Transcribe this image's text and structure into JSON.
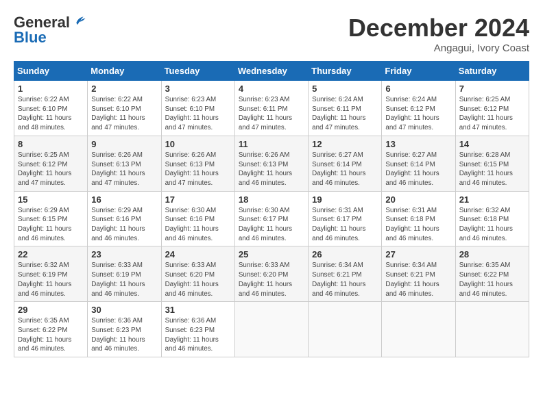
{
  "header": {
    "logo_line1": "General",
    "logo_line2": "Blue",
    "month": "December 2024",
    "location": "Angagui, Ivory Coast"
  },
  "weekdays": [
    "Sunday",
    "Monday",
    "Tuesday",
    "Wednesday",
    "Thursday",
    "Friday",
    "Saturday"
  ],
  "weeks": [
    [
      {
        "day": 1,
        "sunrise": "6:22 AM",
        "sunset": "6:10 PM",
        "daylight": "11 hours and 48 minutes."
      },
      {
        "day": 2,
        "sunrise": "6:22 AM",
        "sunset": "6:10 PM",
        "daylight": "11 hours and 47 minutes."
      },
      {
        "day": 3,
        "sunrise": "6:23 AM",
        "sunset": "6:10 PM",
        "daylight": "11 hours and 47 minutes."
      },
      {
        "day": 4,
        "sunrise": "6:23 AM",
        "sunset": "6:11 PM",
        "daylight": "11 hours and 47 minutes."
      },
      {
        "day": 5,
        "sunrise": "6:24 AM",
        "sunset": "6:11 PM",
        "daylight": "11 hours and 47 minutes."
      },
      {
        "day": 6,
        "sunrise": "6:24 AM",
        "sunset": "6:12 PM",
        "daylight": "11 hours and 47 minutes."
      },
      {
        "day": 7,
        "sunrise": "6:25 AM",
        "sunset": "6:12 PM",
        "daylight": "11 hours and 47 minutes."
      }
    ],
    [
      {
        "day": 8,
        "sunrise": "6:25 AM",
        "sunset": "6:12 PM",
        "daylight": "11 hours and 47 minutes."
      },
      {
        "day": 9,
        "sunrise": "6:26 AM",
        "sunset": "6:13 PM",
        "daylight": "11 hours and 47 minutes."
      },
      {
        "day": 10,
        "sunrise": "6:26 AM",
        "sunset": "6:13 PM",
        "daylight": "11 hours and 47 minutes."
      },
      {
        "day": 11,
        "sunrise": "6:26 AM",
        "sunset": "6:13 PM",
        "daylight": "11 hours and 46 minutes."
      },
      {
        "day": 12,
        "sunrise": "6:27 AM",
        "sunset": "6:14 PM",
        "daylight": "11 hours and 46 minutes."
      },
      {
        "day": 13,
        "sunrise": "6:27 AM",
        "sunset": "6:14 PM",
        "daylight": "11 hours and 46 minutes."
      },
      {
        "day": 14,
        "sunrise": "6:28 AM",
        "sunset": "6:15 PM",
        "daylight": "11 hours and 46 minutes."
      }
    ],
    [
      {
        "day": 15,
        "sunrise": "6:29 AM",
        "sunset": "6:15 PM",
        "daylight": "11 hours and 46 minutes."
      },
      {
        "day": 16,
        "sunrise": "6:29 AM",
        "sunset": "6:16 PM",
        "daylight": "11 hours and 46 minutes."
      },
      {
        "day": 17,
        "sunrise": "6:30 AM",
        "sunset": "6:16 PM",
        "daylight": "11 hours and 46 minutes."
      },
      {
        "day": 18,
        "sunrise": "6:30 AM",
        "sunset": "6:17 PM",
        "daylight": "11 hours and 46 minutes."
      },
      {
        "day": 19,
        "sunrise": "6:31 AM",
        "sunset": "6:17 PM",
        "daylight": "11 hours and 46 minutes."
      },
      {
        "day": 20,
        "sunrise": "6:31 AM",
        "sunset": "6:18 PM",
        "daylight": "11 hours and 46 minutes."
      },
      {
        "day": 21,
        "sunrise": "6:32 AM",
        "sunset": "6:18 PM",
        "daylight": "11 hours and 46 minutes."
      }
    ],
    [
      {
        "day": 22,
        "sunrise": "6:32 AM",
        "sunset": "6:19 PM",
        "daylight": "11 hours and 46 minutes."
      },
      {
        "day": 23,
        "sunrise": "6:33 AM",
        "sunset": "6:19 PM",
        "daylight": "11 hours and 46 minutes."
      },
      {
        "day": 24,
        "sunrise": "6:33 AM",
        "sunset": "6:20 PM",
        "daylight": "11 hours and 46 minutes."
      },
      {
        "day": 25,
        "sunrise": "6:33 AM",
        "sunset": "6:20 PM",
        "daylight": "11 hours and 46 minutes."
      },
      {
        "day": 26,
        "sunrise": "6:34 AM",
        "sunset": "6:21 PM",
        "daylight": "11 hours and 46 minutes."
      },
      {
        "day": 27,
        "sunrise": "6:34 AM",
        "sunset": "6:21 PM",
        "daylight": "11 hours and 46 minutes."
      },
      {
        "day": 28,
        "sunrise": "6:35 AM",
        "sunset": "6:22 PM",
        "daylight": "11 hours and 46 minutes."
      }
    ],
    [
      {
        "day": 29,
        "sunrise": "6:35 AM",
        "sunset": "6:22 PM",
        "daylight": "11 hours and 46 minutes."
      },
      {
        "day": 30,
        "sunrise": "6:36 AM",
        "sunset": "6:23 PM",
        "daylight": "11 hours and 46 minutes."
      },
      {
        "day": 31,
        "sunrise": "6:36 AM",
        "sunset": "6:23 PM",
        "daylight": "11 hours and 46 minutes."
      },
      null,
      null,
      null,
      null
    ]
  ]
}
